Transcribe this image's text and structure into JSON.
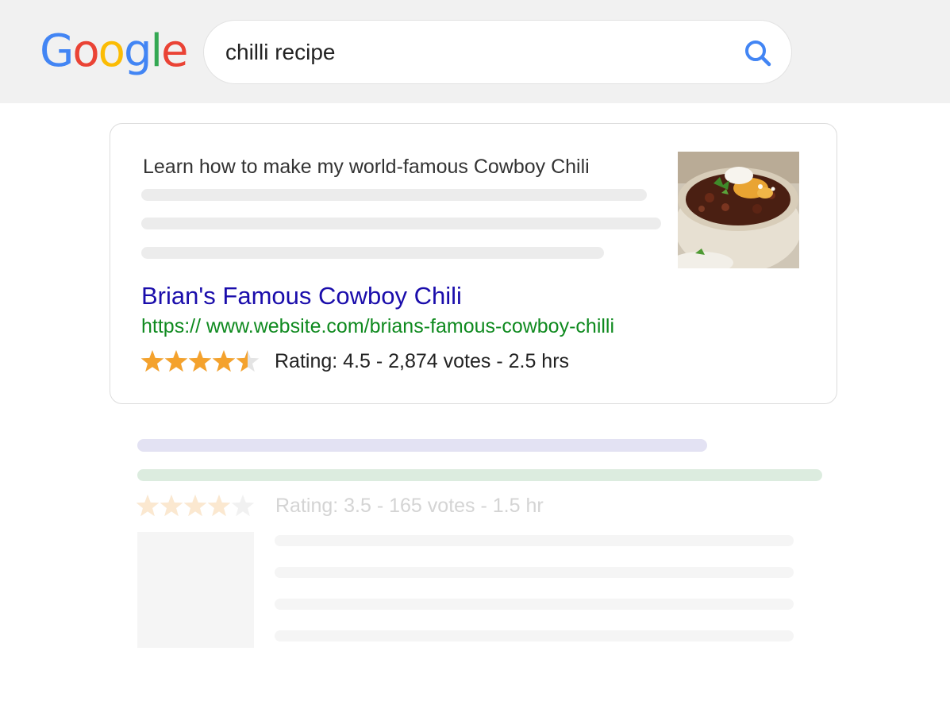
{
  "header": {
    "logo_letters": [
      {
        "char": "G",
        "color": "#4285F4"
      },
      {
        "char": "o",
        "color": "#EA4335"
      },
      {
        "char": "o",
        "color": "#FBBC05"
      },
      {
        "char": "g",
        "color": "#4285F4"
      },
      {
        "char": "l",
        "color": "#34A853"
      },
      {
        "char": "e",
        "color": "#EA4335"
      }
    ],
    "search": {
      "value": "chilli recipe",
      "icon": "search-icon",
      "icon_color": "#4285F4"
    }
  },
  "featured_result": {
    "snippet_heading": "Learn how to make my world-famous Cowboy Chili",
    "thumbnail": "chili-bowl-photo",
    "title": "Brian's Famous Cowboy Chili",
    "url": "https:// www.website.com/brians-famous-cowboy-chilli",
    "rating": {
      "stars": 4.5,
      "max": 5,
      "text": "Rating: 4.5 - 2,874 votes - 2.5 hrs"
    },
    "colors": {
      "title": "#1a0dab",
      "url": "#0f8a1f",
      "star": "#F4A22D"
    }
  },
  "faded_result": {
    "rating": {
      "stars": 4,
      "max": 5,
      "text": "Rating: 3.5 - 165 votes - 1.5 hr"
    },
    "colors": {
      "title_bar": "#e3e2f3",
      "url_bar": "#dcecdf",
      "star": "#fbe8d0",
      "star_empty": "#f1f1f1"
    }
  }
}
